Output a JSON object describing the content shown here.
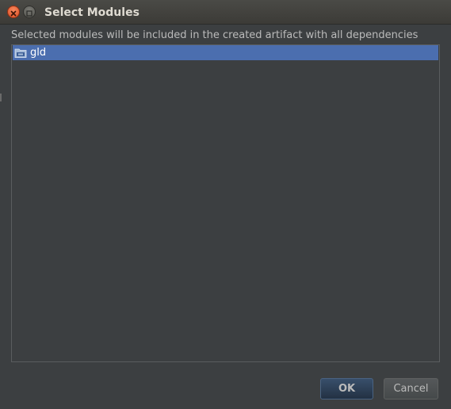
{
  "window": {
    "title": "Select Modules",
    "controls": [
      "close-icon",
      "maximize-icon"
    ]
  },
  "dialog": {
    "description": "Selected modules will be included in the created artifact with all dependencies",
    "modules": [
      {
        "label": "gld",
        "icon": "module-folder-icon",
        "selected": true
      }
    ]
  },
  "buttons": {
    "ok_label": "OK",
    "cancel_label": "Cancel"
  },
  "colors": {
    "background": "#3c3f41",
    "selection": "#4b6eaf",
    "close_button": "#e2562b",
    "text": "#bbbbbb"
  }
}
